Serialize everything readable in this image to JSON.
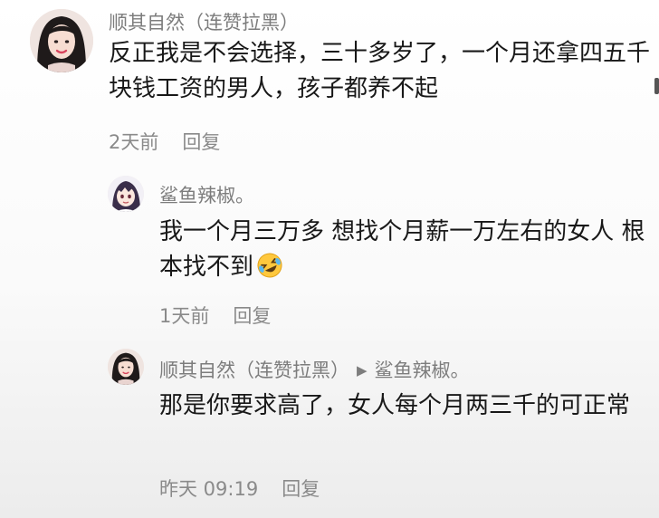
{
  "comments": [
    {
      "username": "顺其自然（连赞拉黑）",
      "text": "反正我是不会选择，三十多岁了，一个月还拿四五千块钱工资的男人，孩子都养不起",
      "time": "2天前",
      "reply_label": "回复",
      "avatar_icon": "woman-portrait-avatar"
    },
    {
      "username": "鲨鱼辣椒。",
      "text": "我一个月三万多 想找个月薪一万左右的女人 根本找不到",
      "emoji": "rolling-on-floor-laughing-emoji",
      "time": "1天前",
      "reply_label": "回复",
      "avatar_icon": "anime-boy-avatar"
    },
    {
      "username": "顺其自然（连赞拉黑）",
      "reply_to": "鲨鱼辣椒。",
      "text": "那是你要求高了，女人每个月两三千的可正常",
      "time": "昨天 09:19",
      "reply_label": "回复",
      "avatar_icon": "woman-portrait-avatar"
    }
  ],
  "colors": {
    "text": "#181818",
    "meta": "#8a8a8a",
    "username": "#7d7d7d",
    "background": "#ffffff"
  }
}
